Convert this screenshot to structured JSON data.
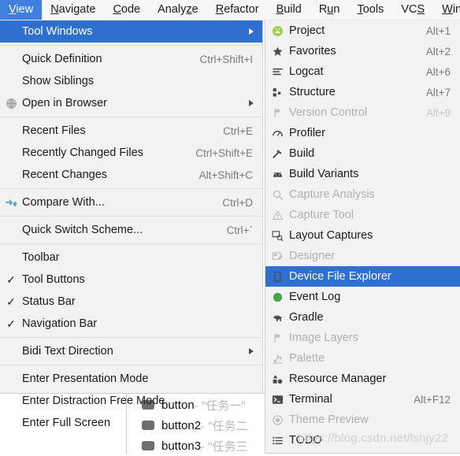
{
  "menubar": {
    "items": [
      {
        "label": "View",
        "mnemonic": "V",
        "selected": true
      },
      {
        "label": "Navigate",
        "mnemonic": "N",
        "selected": false
      },
      {
        "label": "Code",
        "mnemonic": "C",
        "selected": false
      },
      {
        "label": "Analyze",
        "mnemonic": "z",
        "selected": false
      },
      {
        "label": "Refactor",
        "mnemonic": "R",
        "selected": false
      },
      {
        "label": "Build",
        "mnemonic": "B",
        "selected": false
      },
      {
        "label": "Run",
        "mnemonic": "u",
        "selected": false
      },
      {
        "label": "Tools",
        "mnemonic": "T",
        "selected": false
      },
      {
        "label": "VCS",
        "mnemonic": "S",
        "selected": false
      },
      {
        "label": "Windo",
        "mnemonic": "W",
        "selected": false
      }
    ]
  },
  "view_menu": {
    "items": [
      {
        "label": "Tool Windows",
        "accel": "",
        "icon": "none",
        "submenu": true,
        "highlighted": true,
        "checked": false,
        "disabled": false
      },
      {
        "type": "separator"
      },
      {
        "label": "Quick Definition",
        "accel": "Ctrl+Shift+I",
        "icon": "none",
        "submenu": false,
        "highlighted": false,
        "checked": false,
        "disabled": false
      },
      {
        "label": "Show Siblings",
        "accel": "",
        "icon": "none",
        "submenu": false,
        "highlighted": false,
        "checked": false,
        "disabled": false
      },
      {
        "label": "Open in Browser",
        "accel": "",
        "icon": "globe-icon",
        "submenu": true,
        "highlighted": false,
        "checked": false,
        "disabled": false
      },
      {
        "type": "separator"
      },
      {
        "label": "Recent Files",
        "accel": "Ctrl+E",
        "icon": "none",
        "submenu": false,
        "highlighted": false,
        "checked": false,
        "disabled": false
      },
      {
        "label": "Recently Changed Files",
        "accel": "Ctrl+Shift+E",
        "icon": "none",
        "submenu": false,
        "highlighted": false,
        "checked": false,
        "disabled": false
      },
      {
        "label": "Recent Changes",
        "accel": "Alt+Shift+C",
        "icon": "none",
        "submenu": false,
        "highlighted": false,
        "checked": false,
        "disabled": false
      },
      {
        "type": "separator"
      },
      {
        "label": "Compare With...",
        "accel": "Ctrl+D",
        "icon": "compare-icon",
        "submenu": false,
        "highlighted": false,
        "checked": false,
        "disabled": false
      },
      {
        "type": "separator"
      },
      {
        "label": "Quick Switch Scheme...",
        "accel": "Ctrl+`",
        "icon": "none",
        "submenu": false,
        "highlighted": false,
        "checked": false,
        "disabled": false
      },
      {
        "type": "separator"
      },
      {
        "label": "Toolbar",
        "accel": "",
        "icon": "none",
        "submenu": false,
        "checked": false,
        "disabled": false
      },
      {
        "label": "Tool Buttons",
        "accel": "",
        "icon": "none",
        "submenu": false,
        "checked": true,
        "disabled": false
      },
      {
        "label": "Status Bar",
        "accel": "",
        "icon": "none",
        "submenu": false,
        "checked": true,
        "disabled": false
      },
      {
        "label": "Navigation Bar",
        "accel": "",
        "icon": "none",
        "submenu": false,
        "checked": true,
        "disabled": false
      },
      {
        "type": "separator"
      },
      {
        "label": "Bidi Text Direction",
        "accel": "",
        "icon": "none",
        "submenu": true,
        "checked": false,
        "disabled": false
      },
      {
        "type": "separator"
      },
      {
        "label": "Enter Presentation Mode",
        "accel": "",
        "icon": "none",
        "submenu": false,
        "checked": false,
        "disabled": false
      },
      {
        "label": "Enter Distraction Free Mode",
        "accel": "",
        "icon": "none",
        "submenu": false,
        "checked": false,
        "disabled": false
      },
      {
        "label": "Enter Full Screen",
        "accel": "",
        "icon": "none",
        "submenu": false,
        "checked": false,
        "disabled": false
      }
    ]
  },
  "tool_windows_submenu": {
    "items": [
      {
        "label": "Project",
        "accel": "Alt+1",
        "icon": "android-project-icon",
        "disabled": false,
        "highlighted": false
      },
      {
        "label": "Favorites",
        "accel": "Alt+2",
        "icon": "star-icon",
        "disabled": false,
        "highlighted": false
      },
      {
        "label": "Logcat",
        "accel": "Alt+6",
        "icon": "logcat-lines-icon",
        "disabled": false,
        "highlighted": false
      },
      {
        "label": "Structure",
        "accel": "Alt+7",
        "icon": "structure-blocks-icon",
        "disabled": false,
        "highlighted": false
      },
      {
        "label": "Version Control",
        "accel": "Alt+9",
        "icon": "branch-icon",
        "disabled": true,
        "highlighted": false
      },
      {
        "label": "Profiler",
        "accel": "",
        "icon": "gauge-icon",
        "disabled": false,
        "highlighted": false
      },
      {
        "label": "Build",
        "accel": "",
        "icon": "hammer-icon",
        "disabled": false,
        "highlighted": false
      },
      {
        "label": "Build Variants",
        "accel": "",
        "icon": "android-head-icon",
        "disabled": false,
        "highlighted": false
      },
      {
        "label": "Capture Analysis",
        "accel": "",
        "icon": "magnifier-icon",
        "disabled": true,
        "highlighted": false
      },
      {
        "label": "Capture Tool",
        "accel": "",
        "icon": "warning-triangle-icon",
        "disabled": true,
        "highlighted": false
      },
      {
        "label": "Layout Captures",
        "accel": "",
        "icon": "layout-inspect-icon",
        "disabled": false,
        "highlighted": false
      },
      {
        "label": "Designer",
        "accel": "",
        "icon": "designer-icon",
        "disabled": true,
        "highlighted": false
      },
      {
        "label": "Device File Explorer",
        "accel": "",
        "icon": "phone-icon",
        "disabled": false,
        "highlighted": true
      },
      {
        "label": "Event Log",
        "accel": "",
        "icon": "green-circle-icon",
        "disabled": false,
        "highlighted": false
      },
      {
        "label": "Gradle",
        "accel": "",
        "icon": "gradle-elephant-icon",
        "disabled": false,
        "highlighted": false
      },
      {
        "label": "Image Layers",
        "accel": "",
        "icon": "branch-icon",
        "disabled": true,
        "highlighted": false
      },
      {
        "label": "Palette",
        "accel": "",
        "icon": "palette-icon",
        "disabled": true,
        "highlighted": false
      },
      {
        "label": "Resource Manager",
        "accel": "",
        "icon": "shapes-icon",
        "disabled": false,
        "highlighted": false
      },
      {
        "label": "Terminal",
        "accel": "Alt+F12",
        "icon": "terminal-icon",
        "disabled": false,
        "highlighted": false
      },
      {
        "label": "Theme Preview",
        "accel": "",
        "icon": "theme-circle-icon",
        "disabled": true,
        "highlighted": false
      },
      {
        "label": "TODO",
        "accel": "",
        "icon": "todo-list-icon",
        "disabled": false,
        "highlighted": false
      }
    ]
  },
  "background": {
    "rows": [
      {
        "name": "button",
        "suffix": "- \"任务一\""
      },
      {
        "name": "button2",
        "suffix": "- \"任务二"
      },
      {
        "name": "button3",
        "suffix": "- \"任务三"
      }
    ]
  },
  "watermark": {
    "text": "https://blog.csdn.net/lshjy22"
  },
  "colors": {
    "accent": "#2f6fd0",
    "menubar_accent": "#3e7fe0",
    "menu_bg": "#f2f2f2",
    "disabled_text": "#b0b0b0",
    "accel_text": "#7a7a7a"
  }
}
